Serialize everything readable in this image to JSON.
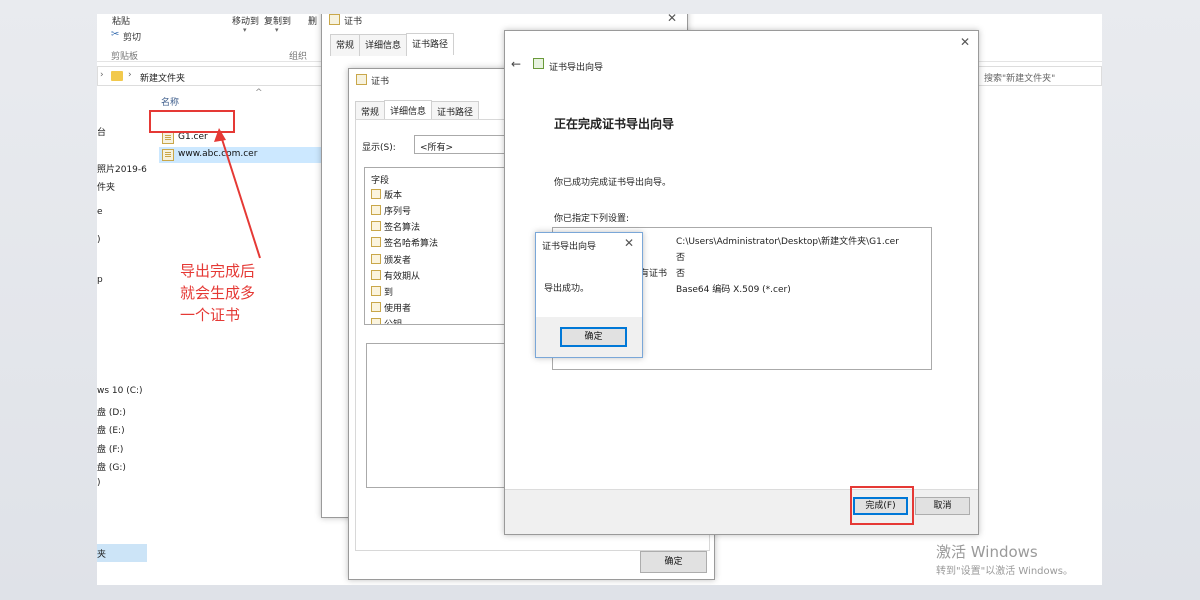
{
  "explorer": {
    "ribbon": {
      "clipboard_paste": "粘贴",
      "clipboard_cut": "剪切",
      "clipboard_group": "剪贴板",
      "move_to": "移动到",
      "copy_to": "复制到",
      "delete_partial": "删",
      "organize_group": "组织"
    },
    "address": {
      "path": "新建文件夹",
      "search_placeholder": "搜索\"新建文件夹\""
    },
    "nav": {
      "items": [
        "台",
        "照片2019-6-",
        "件夹",
        "e",
        ")",
        "p",
        "ws 10 (C:)",
        "盘 (D:)",
        "盘 (E:)",
        "盘 (F:)",
        "盘 (G:)",
        ")",
        "夹"
      ]
    },
    "filelist": {
      "column_name": "名称",
      "files": [
        "G1.cer",
        "www.abc.com.cer"
      ]
    }
  },
  "annotation": {
    "lines": [
      "导出完成后",
      "就会生成多",
      "一个证书"
    ]
  },
  "cert_dialog_back": {
    "title": "证书",
    "tabs": [
      "常规",
      "详细信息",
      "证书路径"
    ]
  },
  "cert_dialog": {
    "title": "证书",
    "tabs": [
      "常规",
      "详细信息",
      "证书路径"
    ],
    "show_label": "显示(S):",
    "show_value": "<所有>",
    "field_header": "字段",
    "fields": [
      "版本",
      "序列号",
      "签名算法",
      "签名哈希算法",
      "颁发者",
      "有效期从",
      "到",
      "使用者",
      "公钥"
    ],
    "ok_button": "确定"
  },
  "wizard": {
    "title": "证书导出向导",
    "heading": "正在完成证书导出向导",
    "success_text": "你已成功完成证书导出向导。",
    "settings_label": "你已指定下列设置:",
    "settings_values": [
      "C:\\Users\\Administrator\\Desktop\\新建文件夹\\G1.cer",
      "否",
      "否",
      "Base64 编码 X.509 (*.cer)"
    ],
    "partial_label": "有证书",
    "finish_button": "完成(F)",
    "cancel_button": "取消"
  },
  "popup": {
    "title": "证书导出向导",
    "message": "导出成功。",
    "ok_button": "确定"
  },
  "watermark": {
    "line1": "激活 Windows",
    "line2": "转到\"设置\"以激活 Windows。"
  }
}
